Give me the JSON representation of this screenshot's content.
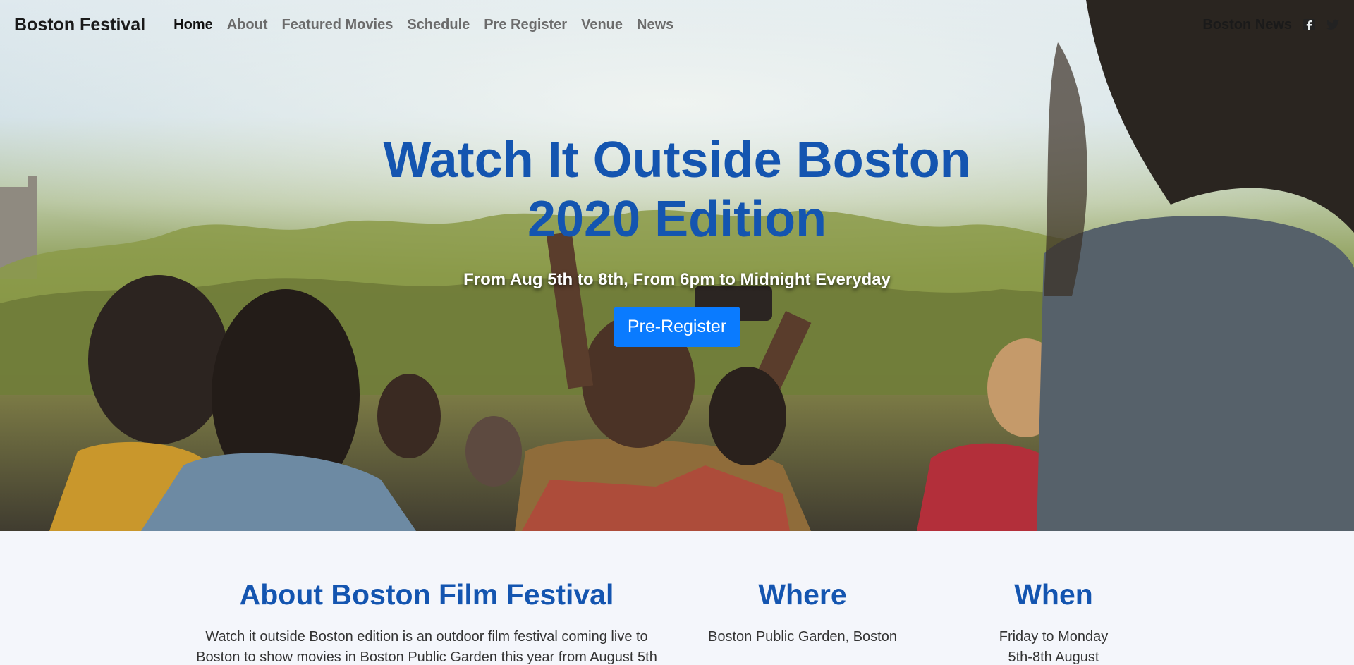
{
  "nav": {
    "brand": "Boston Festival",
    "links": [
      "Home",
      "About",
      "Featured Movies",
      "Schedule",
      "Pre Register",
      "Venue",
      "News"
    ],
    "right_link": "Boston News",
    "social": [
      "facebook-icon",
      "twitter-icon"
    ]
  },
  "hero": {
    "title_line1": "Watch It Outside Boston",
    "title_line2": "2020 Edition",
    "subtitle": "From Aug 5th to 8th, From 6pm to Midnight Everyday",
    "cta": "Pre-Register"
  },
  "info": {
    "about": {
      "heading": "About Boston Film Festival",
      "text_line1": "Watch it outside Boston edition is an outdoor film festival coming live to",
      "text_line2": "Boston to show movies in Boston Public Garden this year from August 5th"
    },
    "where": {
      "heading": "Where",
      "text": "Boston Public Garden, Boston"
    },
    "when": {
      "heading": "When",
      "text_line1": "Friday to Monday",
      "text_line2": "5th-8th August"
    }
  },
  "colors": {
    "accent_blue": "#1455b0",
    "button_blue": "#0a7bff",
    "section_bg": "#f4f6fb"
  }
}
